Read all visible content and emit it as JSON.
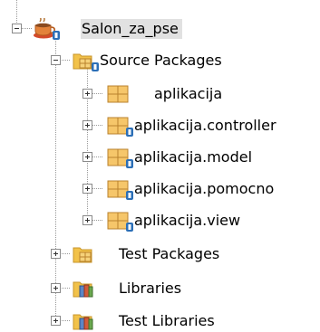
{
  "colors": {
    "folder_yellow": "#f2c24a",
    "folder_dark": "#c8952a",
    "package_fill": "#f6c66a",
    "package_line": "#b9822d",
    "java_badge": "#2c6fb7",
    "selection_bg": "#e1e1e1",
    "tree_line": "#9a9a9a"
  },
  "tree": {
    "project": {
      "label": "Salon_za_pse",
      "icon": "coffee-cup-project-icon",
      "expanded": true
    },
    "source_packages": {
      "label": "Source Packages",
      "icon": "source-packages-folder-icon",
      "expanded": true
    },
    "packages": [
      {
        "label": "aplikacija",
        "icon": "package-icon",
        "badge": false
      },
      {
        "label": "aplikacija.controller",
        "icon": "package-icon",
        "badge": true
      },
      {
        "label": "aplikacija.model",
        "icon": "package-icon",
        "badge": true
      },
      {
        "label": "aplikacija.pomocno",
        "icon": "package-icon",
        "badge": true
      },
      {
        "label": "aplikacija.view",
        "icon": "package-icon",
        "badge": true
      }
    ],
    "others": [
      {
        "label": "Test Packages",
        "icon": "test-packages-folder-icon"
      },
      {
        "label": "Libraries",
        "icon": "libraries-icon"
      },
      {
        "label": "Test Libraries",
        "icon": "test-libraries-icon"
      }
    ]
  }
}
